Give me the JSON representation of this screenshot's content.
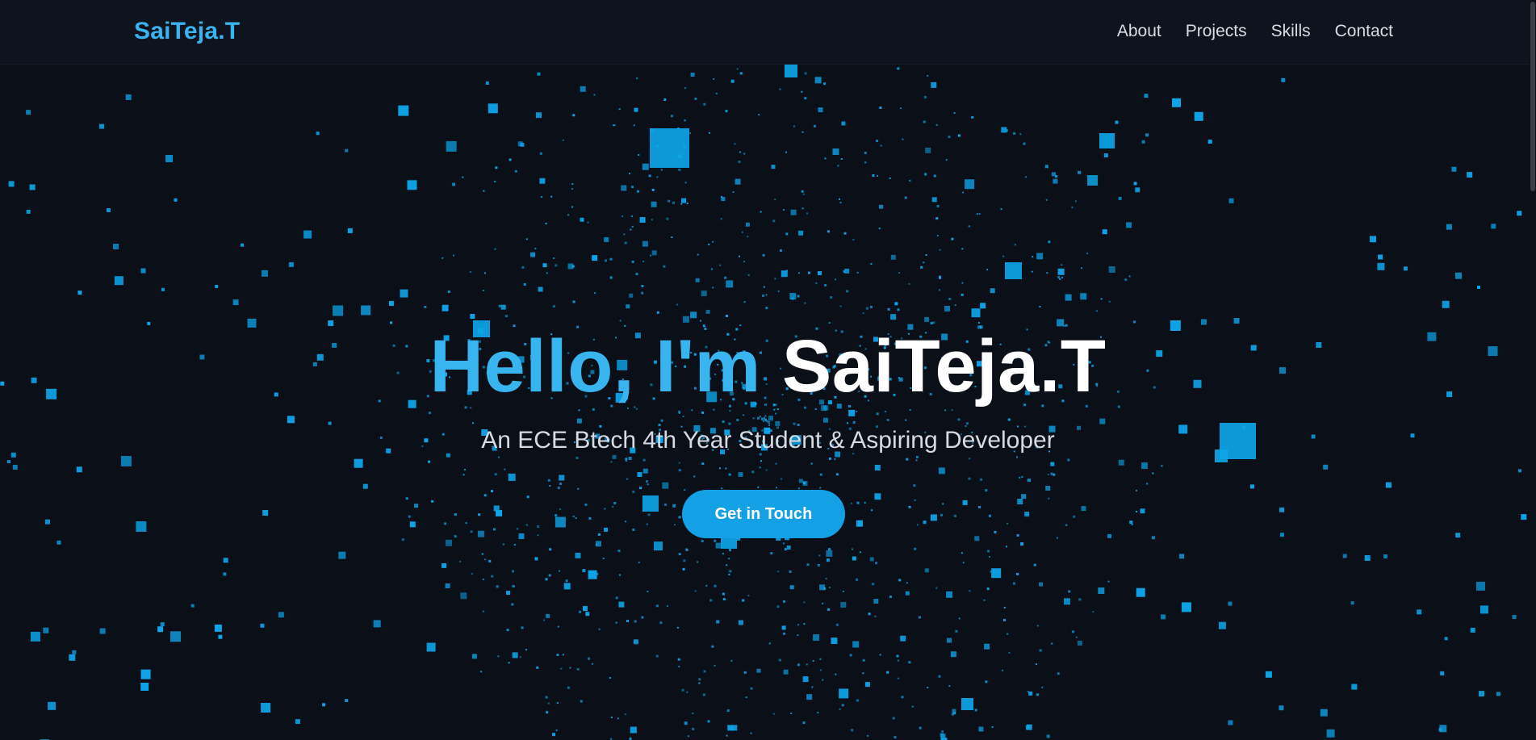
{
  "navbar": {
    "brand": "SaiTeja.T",
    "links": [
      "About",
      "Projects",
      "Skills",
      "Contact"
    ]
  },
  "hero": {
    "greeting": "Hello, I'm",
    "name": "SaiTeja.T",
    "subtitle": "An ECE Btech 4th Year Student & Aspiring Developer",
    "cta_label": "Get in Touch"
  },
  "colors": {
    "background": "#0a0f18",
    "navbar_bg": "#0e131d",
    "accent": "#38b4ee",
    "particle": "#0ea5e9",
    "button": "#13a0e4"
  }
}
